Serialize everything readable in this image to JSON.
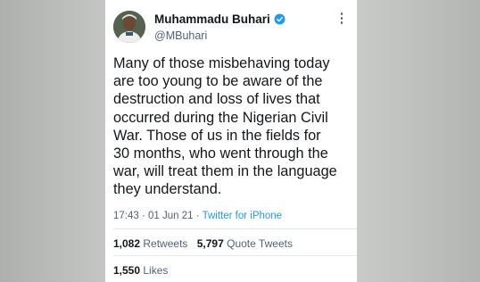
{
  "tweet": {
    "author_name": "Muhammadu Buhari",
    "handle": "@MBuhari",
    "text": "Many of those misbehaving today\nare too young to be aware of the\ndestruction and loss of lives that\noccurred during the Nigerian Civil\nWar. Those of us in the fields for\n30 months, who went through the\nwar, will treat them in the language\nthey understand.",
    "time": "17:43",
    "separator": "·",
    "date": "01 Jun 21",
    "source": "Twitter for iPhone",
    "retweets_count": "1,082",
    "retweets_label": "Retweets",
    "quote_tweets_count": "5,797",
    "quote_tweets_label": "Quote Tweets",
    "likes_count": "1,550",
    "likes_label": "Likes"
  },
  "icons": {
    "verified": "verified-badge-icon",
    "more": "more-options-icon"
  },
  "colors": {
    "accent": "#1d9bf0",
    "text": "#14171a",
    "muted": "#536471"
  }
}
